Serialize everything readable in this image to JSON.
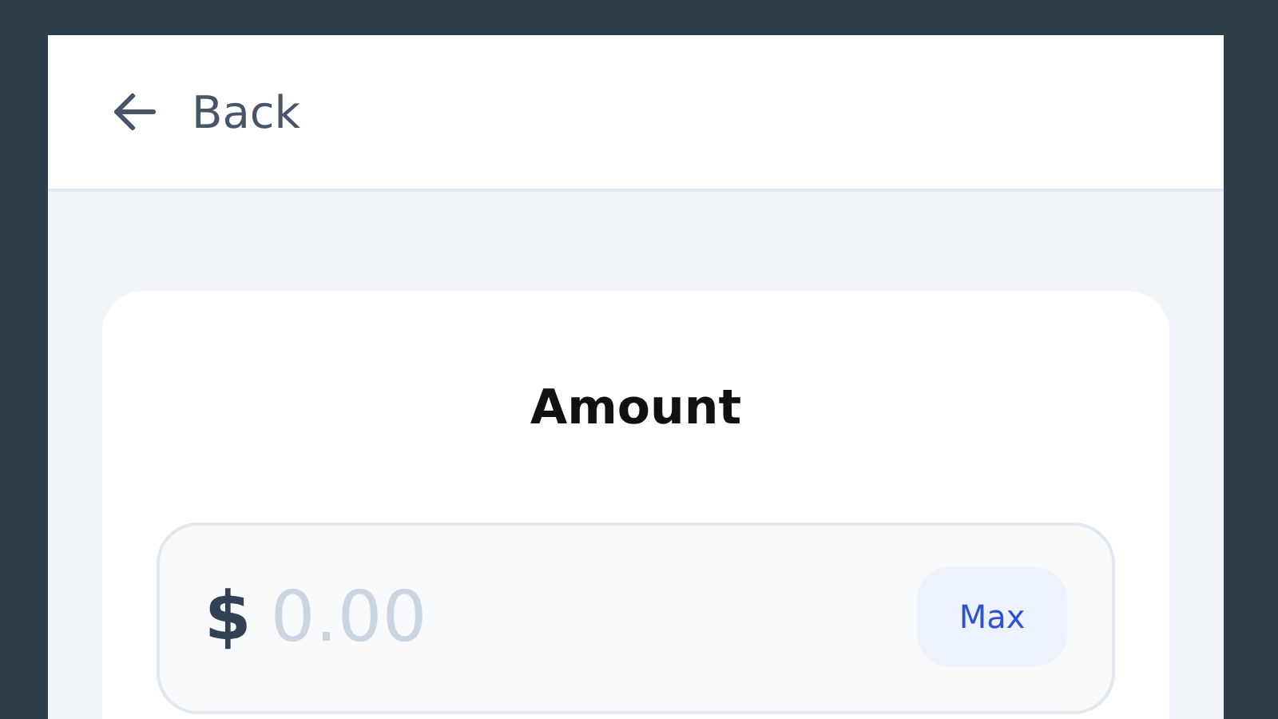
{
  "header": {
    "back_label": "Back"
  },
  "card": {
    "title": "Amount",
    "currency": "$",
    "amount": {
      "placeholder": "0.00"
    },
    "max_button": "Max"
  }
}
